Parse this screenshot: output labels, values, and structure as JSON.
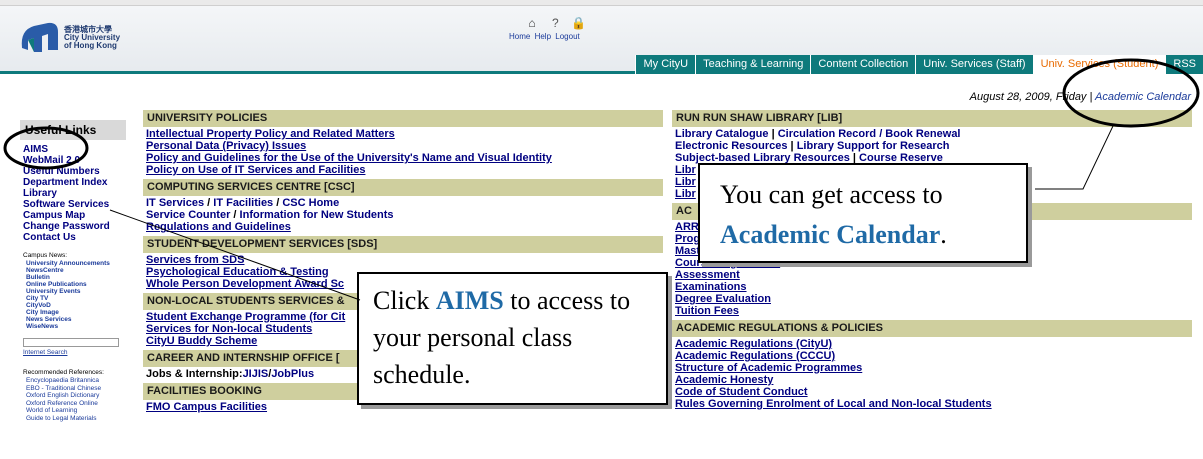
{
  "header": {
    "logo_cn": "香港城市大學",
    "logo_en1": "City University",
    "logo_en2": "of Hong Kong",
    "util_links": [
      "Home",
      "Help",
      "Logout"
    ]
  },
  "tabs": [
    {
      "label": "My CityU"
    },
    {
      "label": "Teaching & Learning"
    },
    {
      "label": "Content Collection"
    },
    {
      "label": "Univ. Services (Staff)"
    },
    {
      "label": "Univ. Services (Student)"
    },
    {
      "label": "RSS"
    }
  ],
  "date": {
    "text": "August 28, 2009, Friday | ",
    "calendar_link": "Academic Calendar"
  },
  "sidebar": {
    "title": "Useful Links",
    "links": [
      "AIMS",
      "WebMail 2.0",
      "Useful Numbers",
      "Department Index",
      "Library",
      "Software Services",
      "Campus Map",
      "Change Password",
      "Contact Us"
    ],
    "news_title": "Campus News:",
    "news": [
      "University Announcements",
      "NewsCentre",
      "Bulletin",
      "Online Publications",
      "University Events",
      "City TV",
      "CityVoD",
      "City Image",
      "News Services",
      "WiseNews"
    ],
    "search_label": "Internet Search",
    "rec_title": "Recommended References:",
    "rec": [
      "Encyclopaedia Britannica",
      "EBO - Traditional Chinese",
      "Oxford English Dictionary",
      "Oxford Reference Online",
      "World of Learning",
      "Guide to Legal Materials"
    ]
  },
  "mid": {
    "policies_head": "UNIVERSITY POLICIES",
    "policies": [
      "Intellectual Property Policy and Related Matters",
      "Personal Data (Privacy) Issues",
      "Policy and Guidelines for the Use of the University's Name and Visual Identity",
      "Policy on Use of IT Services and Facilities"
    ],
    "csc_head": "COMPUTING SERVICES CENTRE [CSC]",
    "csc_line1": [
      "IT Services",
      "IT Facilities",
      "CSC Home"
    ],
    "csc_line2": [
      "Service Counter",
      "Information for New Students"
    ],
    "csc_line3": "Regulations and Guidelines",
    "sds_head": "STUDENT DEVELOPMENT SERVICES [SDS]",
    "sds": [
      "Services from SDS",
      "Psychological Education & Testing",
      "Whole Person Development Award Sc"
    ],
    "nonlocal_head": "NON-LOCAL STUDENTS SERVICES &",
    "nonlocal": [
      "Student Exchange Programme (for Cit",
      "Services for Non-local Students",
      "CityU Buddy Scheme"
    ],
    "career_head": "CAREER AND INTERNSHIP OFFICE [",
    "career_label": "Jobs & Internship:",
    "career_links": [
      "JIJIS",
      "JobPlus"
    ],
    "facilities_head": "FACILITIES BOOKING",
    "facilities": [
      "FMO Campus Facilities"
    ]
  },
  "right": {
    "lib_head": "RUN RUN SHAW LIBRARY [LIB]",
    "lib_line1": [
      "Library Catalogue",
      "Circulation Record / Book Renewal"
    ],
    "lib_line2": [
      "Electronic Resources",
      "Library Support for Research"
    ],
    "lib_line3": [
      "Subject-based Library Resources",
      "Course Reserve"
    ],
    "lib_more": [
      "Libr",
      "Libr",
      "Libr"
    ],
    "acad_head": "AC",
    "acad": [
      "ARR",
      "Prog",
      "Master Class Schedule",
      "Course Registration",
      "Assessment",
      "Examinations",
      "Degree Evaluation",
      "Tuition Fees"
    ],
    "regs_head": "ACADEMIC REGULATIONS & POLICIES",
    "regs": [
      "Academic Regulations (CityU)",
      "Academic Regulations (CCCU)",
      "Structure of Academic Programmes",
      "Academic Honesty",
      "Code of Student Conduct",
      "Rules Governing Enrolment of Local and Non-local Students"
    ]
  },
  "callouts": {
    "aims_pre": "Click ",
    "aims_bold": "AIMS",
    "aims_post": " to access to your personal class schedule.",
    "cal_pre": "You can get access to ",
    "cal_bold": "Academic Calendar",
    "cal_post": "."
  }
}
